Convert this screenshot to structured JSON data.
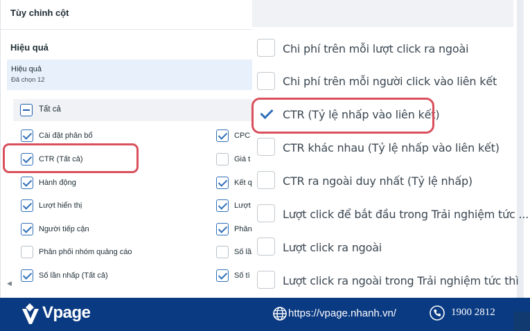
{
  "panel": {
    "title": "Tùy chỉnh cột",
    "section_title": "Hiệu quả",
    "selection": {
      "title": "Hiệu quả",
      "count": "Đã chọn 12"
    },
    "select_all_label": "Tất cả",
    "col1": [
      {
        "label": "Cài đặt phân bổ",
        "checked": true
      },
      {
        "label": "CTR (Tất cả)",
        "checked": true
      },
      {
        "label": "Hành động",
        "checked": true
      },
      {
        "label": "Lượt hiển thị",
        "checked": true
      },
      {
        "label": "Người tiếp cận",
        "checked": true
      },
      {
        "label": "Phân phối nhóm quảng cáo",
        "checked": false
      },
      {
        "label": "Số lần nhấp (Tất cả)",
        "checked": true
      }
    ],
    "col2": [
      {
        "label": "CPC (",
        "checked": true
      },
      {
        "label": "Giá t",
        "checked": false
      },
      {
        "label": "Kết q",
        "checked": true
      },
      {
        "label": "Lượt",
        "checked": true
      },
      {
        "label": "Phân",
        "checked": true
      },
      {
        "label": "Số lầ",
        "checked": false
      },
      {
        "label": "Số tì",
        "checked": true
      }
    ],
    "scroll_arrow": "◀"
  },
  "dropdown": {
    "options": [
      {
        "label": "Chi phí trên mỗi lượt click ra ngoài",
        "checked": false
      },
      {
        "label": "Chi phí trên mỗi người click vào liên kết",
        "checked": false
      },
      {
        "label": "CTR (Tỷ lệ nhấp vào liên kết)",
        "checked": true
      },
      {
        "label": "CTR khác nhau (Tỷ lệ nhấp vào liên kết)",
        "checked": false
      },
      {
        "label": "CTR ra ngoài duy nhất (Tỷ lệ nhấp)",
        "checked": false
      },
      {
        "label": "Lượt click để bắt đầu trong Trải nghiệm tức ...",
        "checked": false
      },
      {
        "label": "Lượt click ra ngoài",
        "checked": false
      },
      {
        "label": "Lượt click ra ngoài trong Trải nghiệm tức thì",
        "checked": false
      }
    ]
  },
  "footer": {
    "brand": "Vpage",
    "website": "https://vpage.nhanh.vn/",
    "phone": "1900 2812"
  },
  "colors": {
    "footer_bg": "#0a3a82",
    "highlight": "#d94f5c",
    "check": "#2f6fb8",
    "selection_bg": "#e7f0fb"
  },
  "icons": [
    "minus-icon",
    "check-icon",
    "chevron-left-icon",
    "vpage-logo-icon",
    "globe-icon",
    "phone-icon"
  ]
}
